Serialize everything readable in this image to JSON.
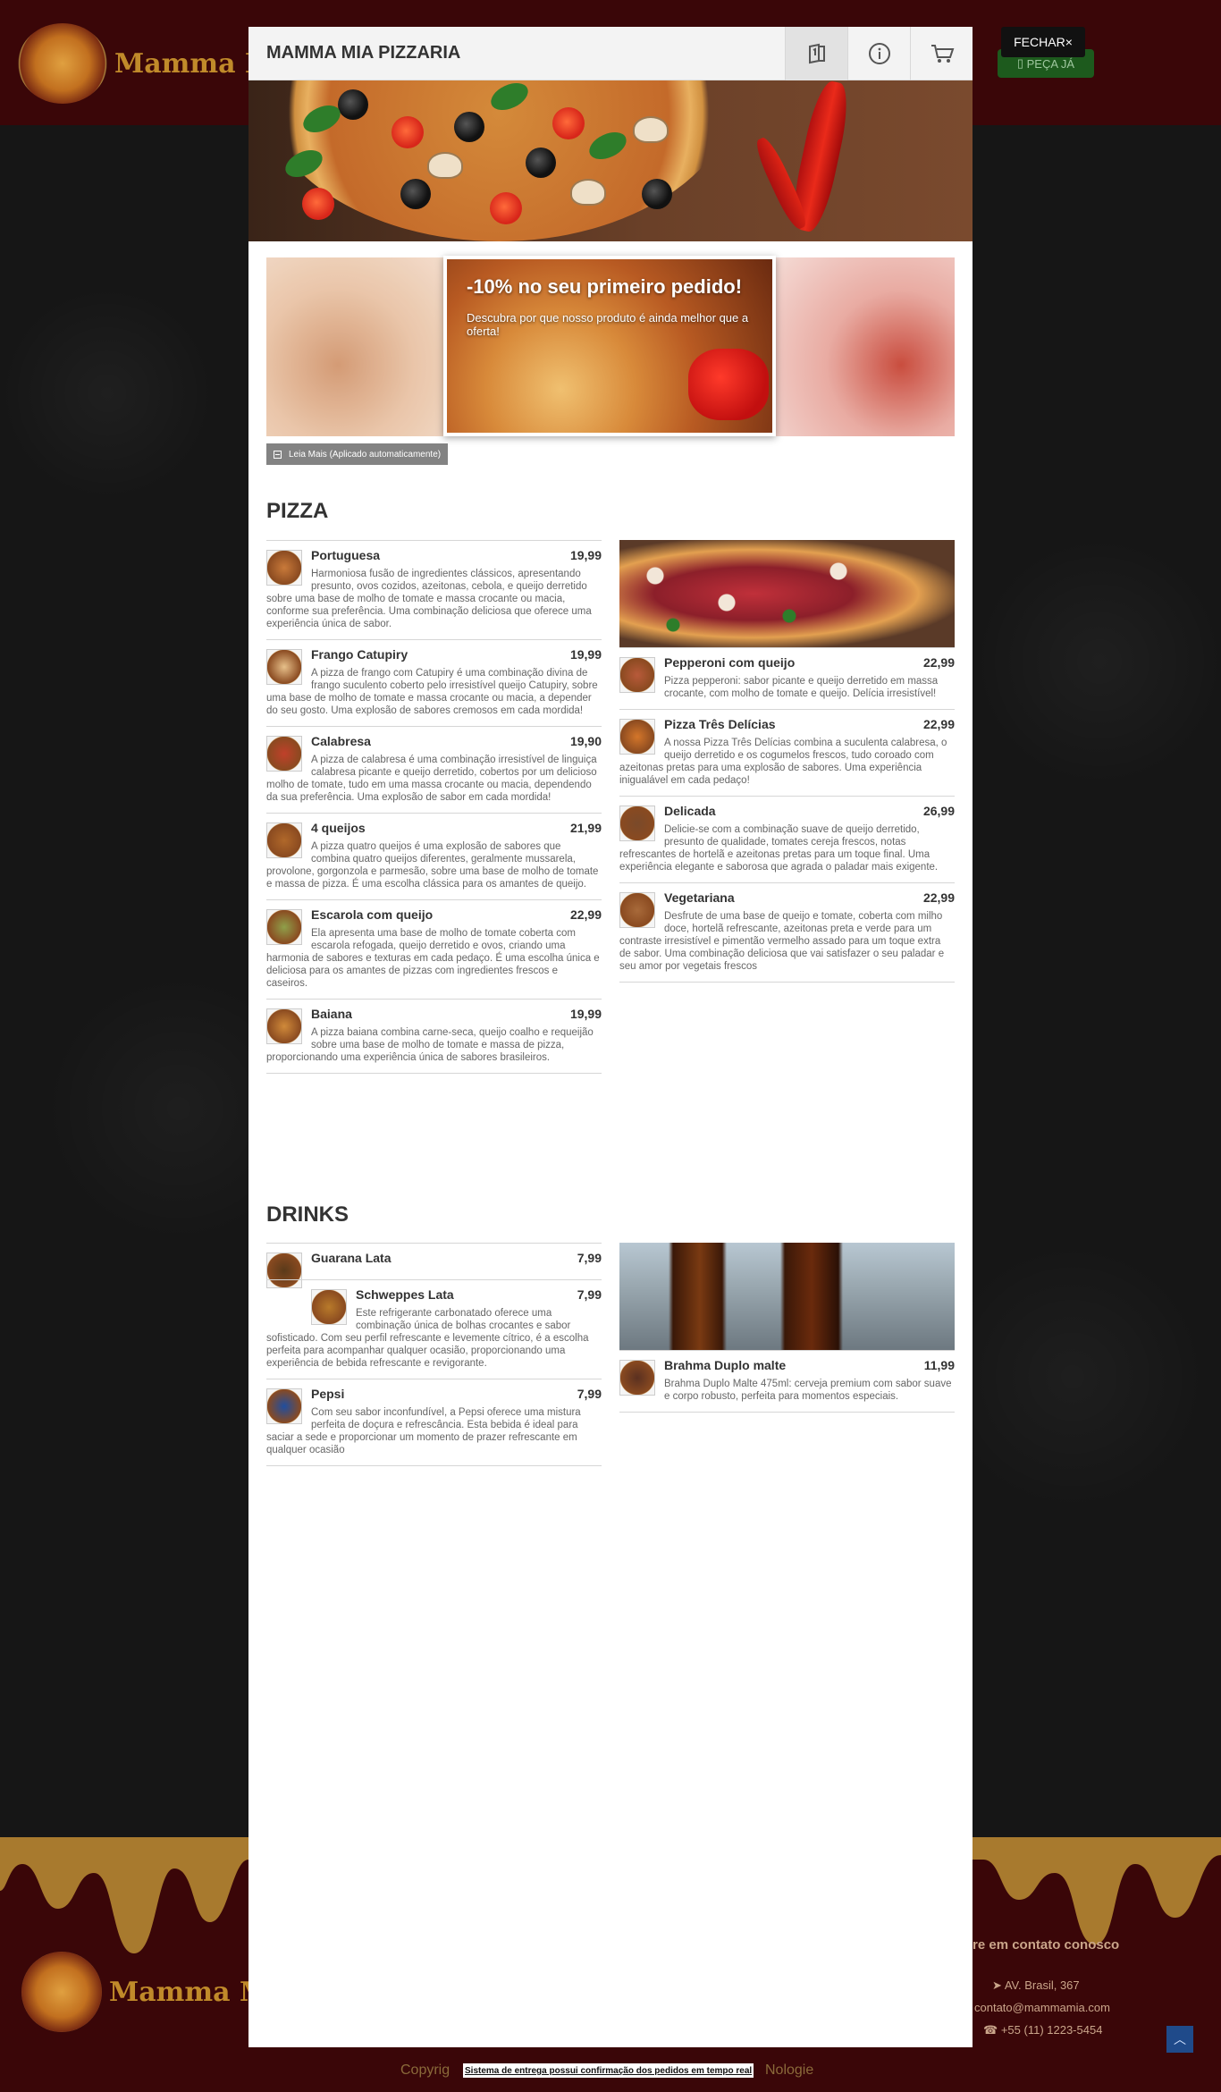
{
  "background": {
    "brand": "Mamma Mi",
    "order_button": "PEÇA JÁ",
    "footer_brand": "Mamma Mia",
    "footer_title": "re em contato conosco",
    "address": "AV. Brasil, 367",
    "email": "contato@mammamia.com",
    "phone": "+55 (11) 1223-5454",
    "copyright_left": "Copyrig",
    "copyright_right": "Nologie"
  },
  "modal": {
    "title": "MAMMA MIA PIZZARIA",
    "icons": [
      "menu-book-icon",
      "info-icon",
      "cart-icon"
    ],
    "close_label": "FECHAR",
    "close_symbol": "×"
  },
  "promo": {
    "title": "-10% no seu primeiro pedido!",
    "subtitle": "Descubra por que nosso produto é ainda melhor que a oferta!",
    "read_more": "Leia Mais (Aplicado automaticamente)"
  },
  "pizza": {
    "title": "PIZZA",
    "left": [
      {
        "name": "Portuguesa",
        "price": "19,99",
        "desc": "Harmoniosa fusão de ingredientes clássicos, apresentando presunto, ovos cozidos, azeitonas, cebola, e queijo derretido sobre uma base de molho de tomate e massa crocante ou macia, conforme sua preferência. Uma combinação deliciosa que oferece uma experiência única de sabor."
      },
      {
        "name": "Frango Catupiry",
        "price": "19,99",
        "desc": "A pizza de frango com Catupiry é uma combinação divina de frango suculento coberto pelo irresistível queijo Catupiry, sobre uma base de molho de tomate e massa crocante ou macia, a depender do seu gosto. Uma explosão de sabores cremosos em cada mordida!"
      },
      {
        "name": "Calabresa",
        "price": "19,90",
        "desc": "A pizza de calabresa é uma combinação irresistível de linguiça calabresa picante e queijo derretido, cobertos por um delicioso molho de tomate, tudo em uma massa crocante ou macia, dependendo da sua preferência. Uma explosão de sabor em cada mordida!"
      },
      {
        "name": "4 queijos",
        "price": "21,99",
        "desc": "A pizza quatro queijos é uma explosão de sabores que combina quatro queijos diferentes, geralmente mussarela, provolone, gorgonzola e parmesão, sobre uma base de molho de tomate e massa de pizza. É uma escolha clássica para os amantes de queijo."
      },
      {
        "name": "Escarola com queijo",
        "price": "22,99",
        "desc": "Ela apresenta uma base de molho de tomate coberta com escarola refogada, queijo derretido e ovos, criando uma harmonia de sabores e texturas em cada pedaço. É uma escolha única e deliciosa para os amantes de pizzas com ingredientes frescos e caseiros."
      },
      {
        "name": "Baiana",
        "price": "19,99",
        "desc": "A pizza baiana combina carne-seca, queijo coalho e requeijão sobre uma base de molho de tomate e massa de pizza, proporcionando uma experiência única de sabores brasileiros."
      }
    ],
    "right": [
      {
        "name": "Pepperoni com queijo",
        "price": "22,99",
        "desc": "Pizza pepperoni: sabor picante e queijo derretido em massa crocante, com molho de tomate e queijo. Delícia irresistível!"
      },
      {
        "name": "Pizza Três Delícias",
        "price": "22,99",
        "desc": "A nossa Pizza Três Delícias combina a suculenta calabresa, o queijo derretido e os cogumelos frescos, tudo coroado com azeitonas pretas para uma explosão de sabores. Uma experiência inigualável em cada pedaço!"
      },
      {
        "name": "Delicada",
        "price": "26,99",
        "desc": "Delicie-se com a combinação suave de queijo derretido, presunto de qualidade, tomates cereja frescos, notas refrescantes de hortelã e azeitonas pretas para um toque final. Uma experiência elegante e saborosa que agrada o paladar mais exigente."
      },
      {
        "name": "Vegetariana",
        "price": "22,99",
        "desc": "Desfrute de uma base de queijo e tomate, coberta com milho doce, hortelã refrescante, azeitonas preta e verde para um contraste irresistível e pimentão vermelho assado para um toque extra de sabor. Uma combinação deliciosa que vai satisfazer o seu paladar e seu amor por vegetais frescos"
      }
    ]
  },
  "drinks": {
    "title": "DRINKS",
    "left": [
      {
        "name": "Guarana Lata",
        "price": "7,99",
        "desc": ""
      },
      {
        "name": "Schweppes Lata",
        "price": "7,99",
        "desc": "Este refrigerante carbonatado oferece uma combinação única de bolhas crocantes e sabor sofisticado. Com seu perfil refrescante e levemente cítrico, é a escolha perfeita para acompanhar qualquer ocasião, proporcionando uma experiência de bebida refrescante e revigorante."
      },
      {
        "name": "Pepsi",
        "price": "7,99",
        "desc": "Com seu sabor inconfundível, a Pepsi oferece uma mistura perfeita de doçura e refrescância. Esta bebida é ideal para saciar a sede e proporcionar um momento de prazer refrescante em qualquer ocasião"
      }
    ],
    "right": [
      {
        "name": "Brahma Duplo malte",
        "price": "11,99",
        "desc": "Brahma Duplo Malte 475ml: cerveja premium com sabor suave e corpo robusto, perfeita para momentos especiais."
      }
    ]
  },
  "toast": "Sistema de entrega possui confirmação dos pedidos em tempo real",
  "colors": {
    "brand_dark": "#3a0608",
    "gold": "#c08a2a",
    "order_green": "#1d5a1d"
  }
}
